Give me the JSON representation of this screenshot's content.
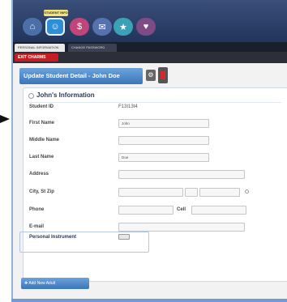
{
  "header": {
    "student_info_tag": "STUDENT INFO",
    "icons": [
      "home-icon",
      "student-icon",
      "money-icon",
      "mail-icon",
      "star-icon",
      "heart-icon"
    ]
  },
  "tabs": [
    {
      "label": "PERSONAL INFORMATION"
    },
    {
      "label": "CHANGE PASSWORD"
    }
  ],
  "exit_label": "EXIT CHARMS",
  "update_title": "Update Student Detail - John Doe",
  "panel": {
    "title": "John's Information",
    "rows": {
      "student_id_label": "Student ID",
      "student_id_value": "F13I13t4",
      "first_name_label": "First Name",
      "first_name_value": "John",
      "middle_name_label": "Middle Name",
      "middle_name_value": "",
      "last_name_label": "Last Name",
      "last_name_value": "Doe",
      "address_label": "Address",
      "city_label": "City, St Zip",
      "phone_label": "Phone",
      "cell_label": "Cell",
      "email_label": "E-mail"
    },
    "instrument_label": "Personal Instrument"
  },
  "add_adult_label": "Add New Adult",
  "colors": {
    "accent_blue": "#3c76b8",
    "exit_red": "#c51d24"
  }
}
